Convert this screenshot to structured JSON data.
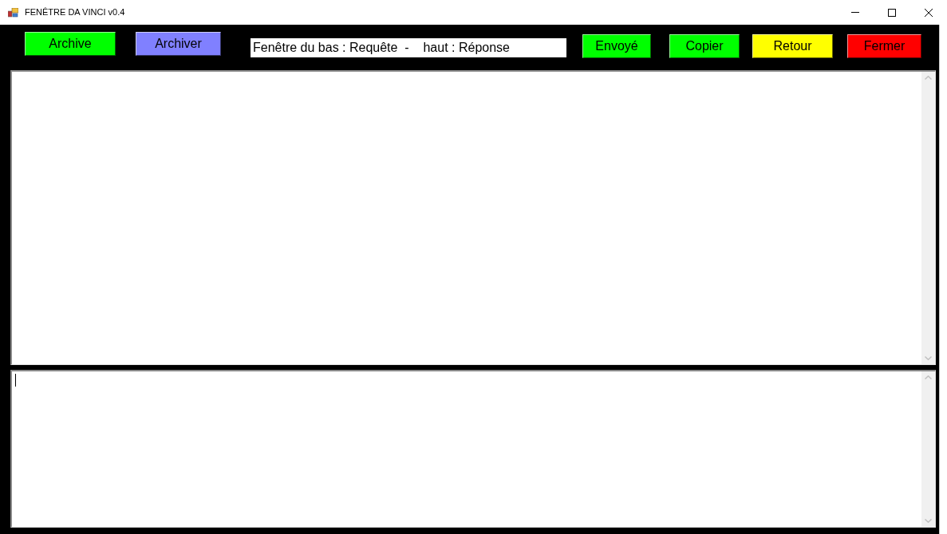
{
  "window": {
    "title": "FENÊTRE DA VINCI v0.4"
  },
  "toolbar": [
    {
      "kind": "button",
      "label": "Archive",
      "color": "#00ff00"
    },
    {
      "kind": "button",
      "label": "Archiver",
      "color": "#8080ff"
    },
    {
      "kind": "field",
      "value": "Fenêtre du bas : Requête  -    haut : Réponse"
    },
    {
      "kind": "button",
      "label": "Envoyé",
      "color": "#00ff00"
    },
    {
      "kind": "button",
      "label": "Copier",
      "color": "#00ff00"
    },
    {
      "kind": "button",
      "label": "Retour",
      "color": "#ffff00"
    },
    {
      "kind": "button",
      "label": "Fermer",
      "color": "#ff0000"
    }
  ],
  "panes": [
    {
      "focused": false
    },
    {
      "focused": true
    }
  ]
}
